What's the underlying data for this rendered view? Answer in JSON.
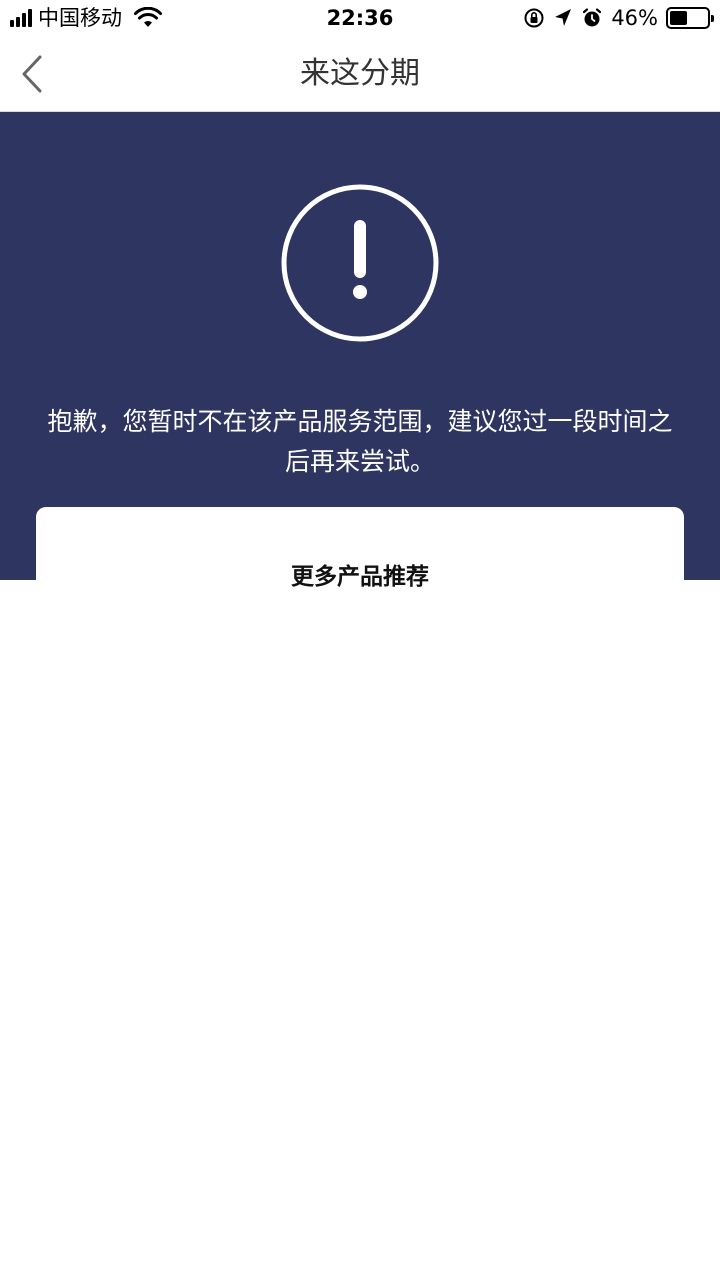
{
  "status_bar": {
    "carrier": "中国移动",
    "time": "22:36",
    "battery_percent": "46%",
    "battery_level": 0.46,
    "icons": [
      "signal-icon",
      "wifi-icon",
      "orientation-lock-icon",
      "location-icon",
      "alarm-icon",
      "battery-icon"
    ]
  },
  "nav": {
    "title": "来这分期",
    "back_icon": "chevron-left-icon"
  },
  "hero": {
    "icon": "exclamation-circle-icon",
    "message": "抱歉，您暂时不在该产品服务范围，建议您过一段时间之后再来尝试。"
  },
  "card": {
    "title": "更多产品推荐"
  },
  "colors": {
    "hero_bg": "#2e3560",
    "white": "#ffffff"
  }
}
